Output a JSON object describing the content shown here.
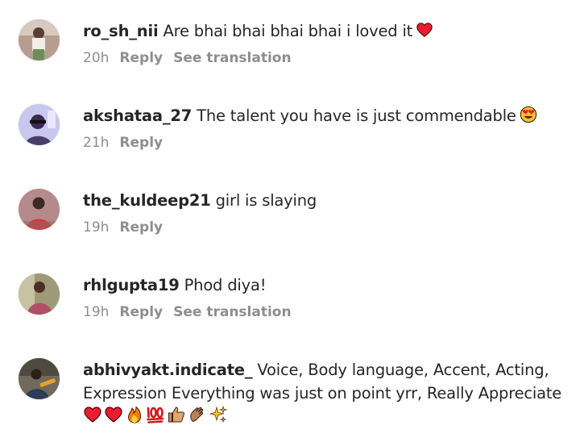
{
  "comments": [
    {
      "username": "ro_sh_nii",
      "text": "Are bhai bhai bhai bhai i loved it",
      "emoji": [
        "red-heart"
      ],
      "time": "20h",
      "reply_label": "Reply",
      "translate_label": "See translation"
    },
    {
      "username": "akshataa_27",
      "text": "The talent you have is just commendable",
      "emoji": [
        "heart-eyes-face"
      ],
      "time": "21h",
      "reply_label": "Reply"
    },
    {
      "username": "the_kuldeep21",
      "text": "girl is slaying",
      "time": "19h",
      "reply_label": "Reply"
    },
    {
      "username": "rhlgupta19",
      "text": "Phod diya!",
      "time": "19h",
      "reply_label": "Reply",
      "translate_label": "See translation"
    },
    {
      "username": "abhivyakt.indicate_",
      "text": "Voice, Body language, Accent, Acting, Expression Everything was just on point yrr, Really Appreciate",
      "emoji": [
        "red-heart",
        "red-heart",
        "fire",
        "hundred-points",
        "thumbs-up",
        "clapping-hands",
        "sparkles"
      ]
    }
  ],
  "colors": {
    "text": "#262626",
    "meta": "#8e8e8e",
    "heart": "#ed1b2e"
  }
}
